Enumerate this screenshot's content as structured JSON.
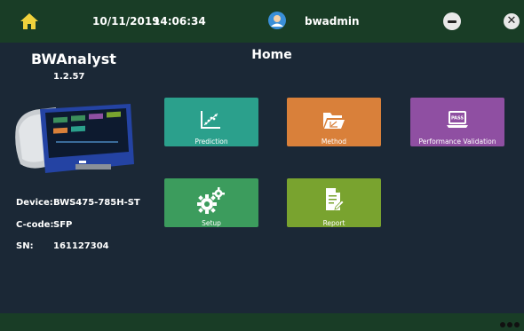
{
  "topbar": {
    "date": "10/11/2019",
    "time": "14:06:34",
    "username": "bwadmin",
    "home_icon": "home-icon",
    "user_icon": "user-avatar-icon",
    "minimize_icon": "minimize-icon",
    "close_icon": "close-icon",
    "close_glyph": "✕"
  },
  "app": {
    "name": "BWAnalyst",
    "version": "1.2.57"
  },
  "page": {
    "title": "Home"
  },
  "device_info": {
    "device_label": "Device:",
    "device_value": "BWS475-785H-ST",
    "ccode_label": "C-code:",
    "ccode_value": "SFP",
    "sn_label": "SN:",
    "sn_value": "161127304"
  },
  "tiles": [
    {
      "label": "Prediction",
      "icon": "scatter-chart-icon",
      "color": "#2ba08c"
    },
    {
      "label": "Method",
      "icon": "folder-icon",
      "color": "#d9803a"
    },
    {
      "label": "Performance Validation",
      "icon": "laptop-pass-icon",
      "color": "#8f4fa2"
    },
    {
      "label": "Setup",
      "icon": "gears-icon",
      "color": "#3c9c5d"
    },
    {
      "label": "Report",
      "icon": "report-icon",
      "color": "#79a32f"
    }
  ],
  "colors": {
    "background": "#1b2836",
    "bar": "#193d26",
    "accent_home": "#f0d23c"
  }
}
